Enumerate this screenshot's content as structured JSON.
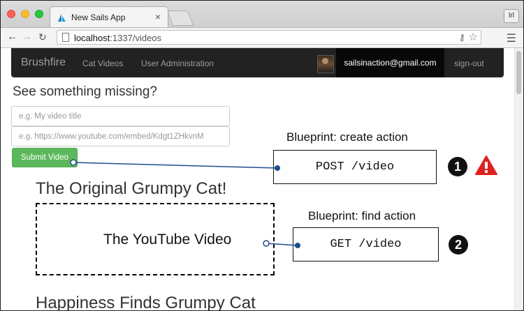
{
  "browser": {
    "tab_title": "New Sails App",
    "tab_close": "×",
    "profile_label": "lrl",
    "url_host": "localhost",
    "url_path": ":1337/videos"
  },
  "navbar": {
    "brand": "Brushfire",
    "links": [
      "Cat Videos",
      "User Administration"
    ],
    "user_email": "sailsinaction@gmail.com",
    "signout": "sign-out"
  },
  "form": {
    "heading": "See something missing?",
    "title_placeholder": "e.g. My video title",
    "src_placeholder": "e.g. https://www.youtube.com/embed/Kdgt1ZHkvnM",
    "submit_label": "Submit Video"
  },
  "videos": [
    {
      "title": "The Original Grumpy Cat!",
      "embed_label": "The YouTube Video"
    },
    {
      "title": "Happiness Finds Grumpy Cat"
    }
  ],
  "annotations": {
    "create": {
      "label": "Blueprint: create action",
      "route": "POST /video",
      "number": "1"
    },
    "find": {
      "label": "Blueprint: find action",
      "route": "GET /video",
      "number": "2"
    },
    "warning_color": "#e02020",
    "connector_color": "#1f4e8c"
  }
}
